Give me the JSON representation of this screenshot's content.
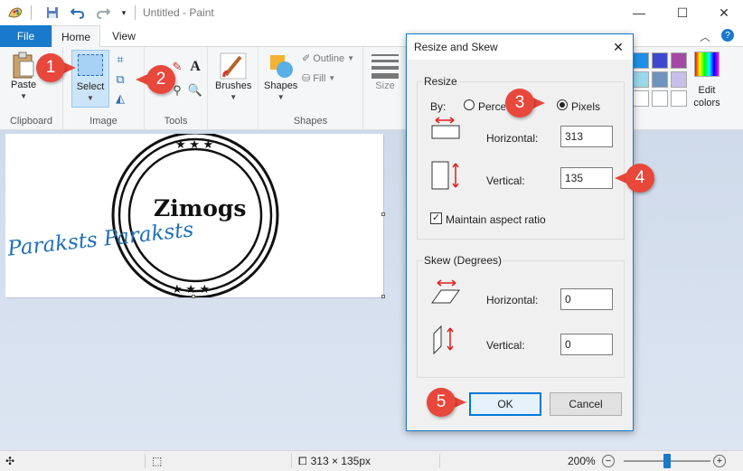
{
  "window": {
    "title": "Untitled - Paint"
  },
  "ribbon": {
    "tabs": {
      "file": "File",
      "home": "Home",
      "view": "View"
    },
    "paste": "Paste",
    "select": "Select",
    "brushes": "Brushes",
    "shapes": "Shapes",
    "outline": "Outline",
    "fill": "Fill",
    "size": "Size",
    "edit_colors": "Edit colors",
    "groups": {
      "clipboard": "Clipboard",
      "image": "Image",
      "tools": "Tools",
      "shapes": "Shapes"
    }
  },
  "canvas": {
    "stamp_text": "Zimogs",
    "signature_text": "Paraksts Paraksts"
  },
  "statusbar": {
    "size": "313 × 135px",
    "zoom": "200%"
  },
  "dialog": {
    "title": "Resize and Skew",
    "resize_legend": "Resize",
    "by_label": "By:",
    "percentage_label": "Percentage",
    "pixels_label": "Pixels",
    "horizontal_label": "Horizontal:",
    "vertical_label": "Vertical:",
    "horizontal_value": "313",
    "vertical_value": "135",
    "maintain_label": "Maintain aspect ratio",
    "skew_legend": "Skew (Degrees)",
    "skew_horizontal_label": "Horizontal:",
    "skew_vertical_label": "Vertical:",
    "skew_horizontal_value": "0",
    "skew_vertical_value": "0",
    "ok": "OK",
    "cancel": "Cancel"
  },
  "callouts": [
    "1",
    "2",
    "3",
    "4",
    "5"
  ],
  "colors": {
    "accent": "#1979ca",
    "callout": "#e8473b",
    "signature": "#1f6fb8"
  }
}
